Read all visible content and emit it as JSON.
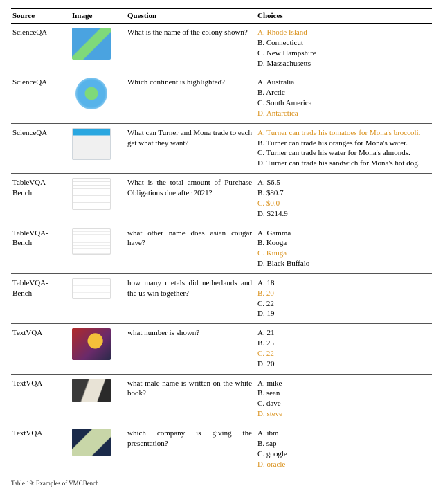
{
  "columns": {
    "source": "Source",
    "image": "Image",
    "question": "Question",
    "choices": "Choices"
  },
  "rows": [
    {
      "source": "ScienceQA",
      "thumb_class": "thumb-map-colony",
      "thumb_name": "map-thumbnail",
      "question": "What is the name of the colony shown?",
      "choices": [
        {
          "label": "A. Rhode Island",
          "correct": true
        },
        {
          "label": "B. Connecticut",
          "correct": false
        },
        {
          "label": "C. New Hampshire",
          "correct": false
        },
        {
          "label": "D. Massachusetts",
          "correct": false
        }
      ]
    },
    {
      "source": "ScienceQA",
      "thumb_class": "thumb-globe",
      "thumb_name": "globe-thumbnail",
      "question": "Which continent is highlighted?",
      "choices": [
        {
          "label": "A. Australia",
          "correct": false
        },
        {
          "label": "B. Arctic",
          "correct": false
        },
        {
          "label": "C. South America",
          "correct": false
        },
        {
          "label": "D. Antarctica",
          "correct": true
        }
      ]
    },
    {
      "source": "ScienceQA",
      "thumb_class": "thumb-trade",
      "thumb_name": "trade-table-thumbnail",
      "question": "What can Turner and Mona trade to each get what they want?",
      "choices": [
        {
          "label": "A. Turner can trade his tomatoes for Mona's broccoli.",
          "correct": true
        },
        {
          "label": "B. Turner can trade his oranges for Mona's water.",
          "correct": false
        },
        {
          "label": "C. Turner can trade his water for Mona's almonds.",
          "correct": false
        },
        {
          "label": "D. Turner can trade his sandwich for Mona's hot dog.",
          "correct": false
        }
      ]
    },
    {
      "source": "TableVQA-Bench",
      "thumb_class": "thumb-tablea",
      "thumb_name": "finance-table-thumbnail",
      "question": "What is the total amount of Purchase Obligations due after 2021?",
      "choices": [
        {
          "label": "A. $6.5",
          "correct": false
        },
        {
          "label": "B. $80.7",
          "correct": false
        },
        {
          "label": "C. $0.0",
          "correct": true
        },
        {
          "label": "D. $214.9",
          "correct": false
        }
      ]
    },
    {
      "source": "TableVQA-Bench",
      "thumb_class": "thumb-tableb",
      "thumb_name": "wiki-table-thumbnail",
      "question": "what other name does asian cougar have?",
      "choices": [
        {
          "label": "A. Gamma",
          "correct": false
        },
        {
          "label": "B. Kooga",
          "correct": false
        },
        {
          "label": "C. Kuuga",
          "correct": true
        },
        {
          "label": "D. Black Buffalo",
          "correct": false
        }
      ]
    },
    {
      "source": "TableVQA-Bench",
      "thumb_class": "thumb-tablec",
      "thumb_name": "medals-table-thumbnail",
      "question": "how many metals did netherlands and the us win together?",
      "choices": [
        {
          "label": "A. 18",
          "correct": false
        },
        {
          "label": "B. 20",
          "correct": true
        },
        {
          "label": "C. 22",
          "correct": false
        },
        {
          "label": "D. 19",
          "correct": false
        }
      ]
    },
    {
      "source": "TextVQA",
      "thumb_class": "thumb-textvqa1",
      "thumb_name": "street-photo-thumbnail",
      "question": "what number is shown?",
      "choices": [
        {
          "label": "A. 21",
          "correct": false
        },
        {
          "label": "B. 25",
          "correct": false
        },
        {
          "label": "C. 22",
          "correct": true
        },
        {
          "label": "D. 20",
          "correct": false
        }
      ]
    },
    {
      "source": "TextVQA",
      "thumb_class": "thumb-textvqa2",
      "thumb_name": "book-photo-thumbnail",
      "question": "what male name is written on the white book?",
      "choices": [
        {
          "label": "A. mike",
          "correct": false
        },
        {
          "label": "B. sean",
          "correct": false
        },
        {
          "label": "C. dave",
          "correct": false
        },
        {
          "label": "D. steve",
          "correct": true
        }
      ]
    },
    {
      "source": "TextVQA",
      "thumb_class": "thumb-textvqa3",
      "thumb_name": "presentation-photo-thumbnail",
      "question": "which company is giving the presentation?",
      "choices": [
        {
          "label": "A. ibm",
          "correct": false
        },
        {
          "label": "B. sap",
          "correct": false
        },
        {
          "label": "C. google",
          "correct": false
        },
        {
          "label": "D. oracle",
          "correct": true
        }
      ]
    }
  ],
  "caption_prefix": "Table 19: Examples of VMCBench"
}
